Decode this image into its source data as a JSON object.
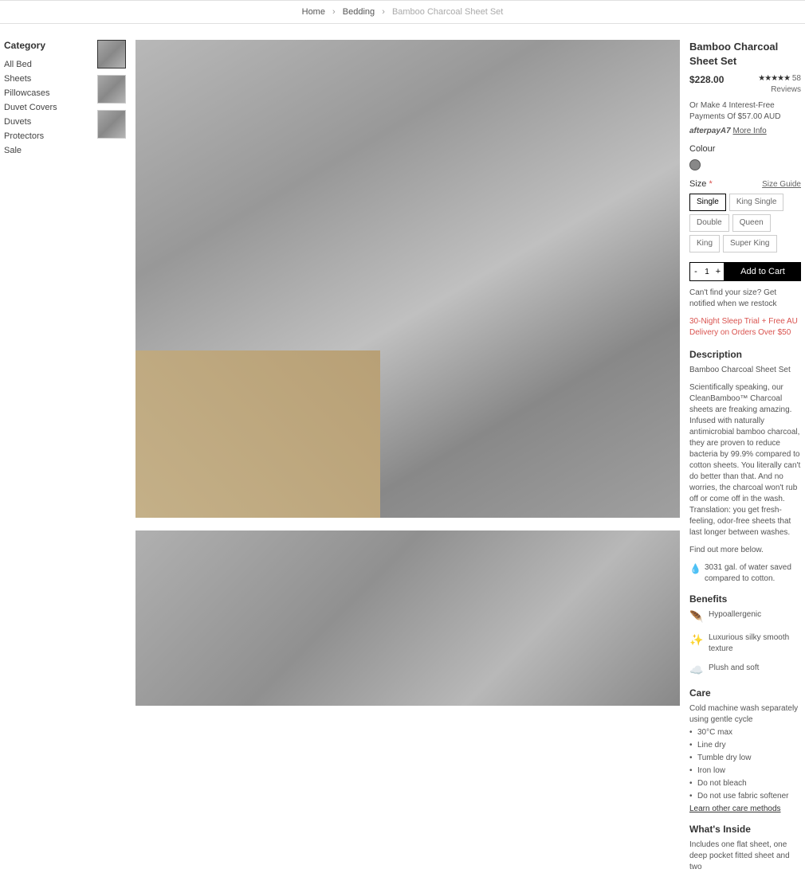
{
  "breadcrumb": {
    "home": "Home",
    "parent": "Bedding",
    "current": "Bamboo Charcoal Sheet Set"
  },
  "sidebar": {
    "heading": "Category",
    "items": [
      "All Bed",
      "Sheets",
      "Pillowcases",
      "Duvet Covers",
      "Duvets",
      "Protectors",
      "Sale"
    ]
  },
  "product": {
    "title": "Bamboo Charcoal Sheet Set",
    "price": "$228.00",
    "reviews_count": "58",
    "reviews_label": "Reviews",
    "installment": "Or Make 4 Interest-Free Payments Of $57.00 AUD",
    "afterpay_logo": "afterpayA7",
    "more_info": "More Info",
    "colour_label": "Colour",
    "colour_swatch": "#888888",
    "size_label": "Size",
    "size_guide": "Size Guide",
    "sizes": [
      "Single",
      "King Single",
      "Double",
      "Queen",
      "King",
      "Super King"
    ],
    "selected_size": "Single",
    "quantity": "1",
    "add_to_cart": "Add to Cart",
    "notify": "Can't find your size? Get notified when we restock",
    "promo": "30-Night Sleep Trial + Free AU Delivery on Orders Over $50",
    "description_heading": "Description",
    "description_title": "Bamboo Charcoal Sheet Set",
    "description_body": "Scientifically speaking, our CleanBamboo™ Charcoal sheets are freaking amazing. Infused with naturally antimicrobial bamboo charcoal, they are proven to reduce bacteria by 99.9% compared to cotton sheets. You literally can't do better than that. And no worries, the charcoal won't rub off or come off in the wash. Translation: you get fresh-feeling, odor-free sheets that last longer between washes.",
    "description_more": "Find out more below.",
    "water_saved": "3031 gal. of water saved compared to cotton.",
    "benefits_heading": "Benefits",
    "benefits": [
      {
        "icon": "🪶",
        "text": "Hypoallergenic"
      },
      {
        "icon": "✨",
        "text": "Luxurious silky smooth texture"
      },
      {
        "icon": "☁️",
        "text": "Plush and soft"
      }
    ],
    "care_heading": "Care",
    "care_intro": "Cold machine wash separately using gentle cycle",
    "care_items": [
      "30°C max",
      "Line dry",
      "Tumble dry low",
      "Iron low",
      "Do not bleach",
      "Do not use fabric softener"
    ],
    "care_link": "Learn other care methods",
    "inside_heading": "What's Inside",
    "inside_text": "Includes one flat sheet, one deep pocket fitted sheet and two"
  }
}
